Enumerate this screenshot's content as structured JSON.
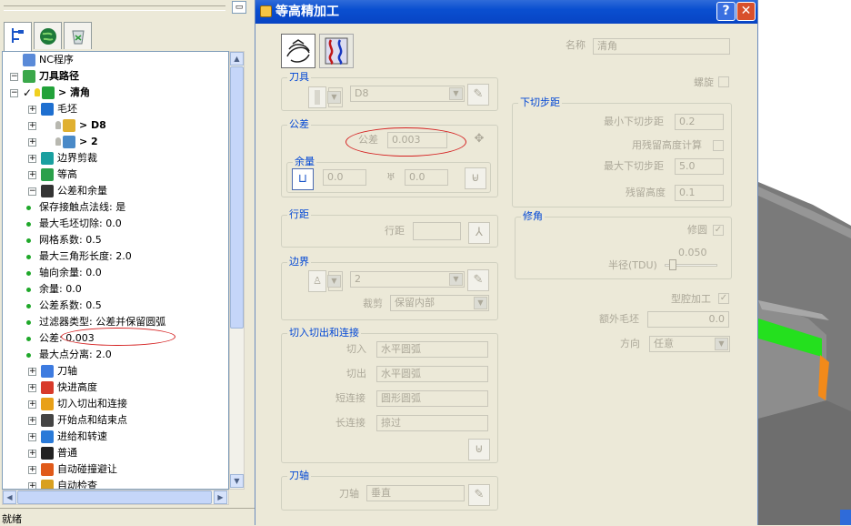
{
  "colors": {
    "title_bar": "#0a4fd0",
    "group_label": "#0046d5",
    "disabled_text": "#aca899",
    "annotation": "#d42020",
    "toolpath_green": "#24e01e",
    "toolpath_orange": "#f28a1a"
  },
  "tree": {
    "items": [
      {
        "label": "NC程序",
        "bold": false,
        "icon": "nc-program-icon",
        "indent": 1,
        "exp": ""
      },
      {
        "label": "刀具路径",
        "bold": true,
        "icon": "toolpath-icon",
        "indent": 0,
        "exp": "-"
      },
      {
        "label": "> 清角",
        "bold": true,
        "icon": "active-toolpath-icon",
        "indent": 1,
        "exp": "-",
        "check": true
      },
      {
        "label": "毛坯",
        "bold": false,
        "icon": "block-icon",
        "indent": 2,
        "exp": "+"
      },
      {
        "label": "> D8",
        "bold": true,
        "icon": "tool-d8-icon",
        "indent": 2,
        "exp": "+",
        "bulb": true
      },
      {
        "label": "> 2",
        "bold": true,
        "icon": "tool-2-icon",
        "indent": 2,
        "exp": "+",
        "bulb": true
      },
      {
        "label": "边界剪裁",
        "bold": false,
        "icon": "boundary-icon",
        "indent": 2,
        "exp": "+"
      },
      {
        "label": "等高",
        "bold": false,
        "icon": "constant-z-icon",
        "indent": 2,
        "exp": "+"
      },
      {
        "label": "公差和余量",
        "bold": false,
        "icon": "tolerance-icon",
        "indent": 2,
        "exp": "-"
      },
      {
        "label": "保存接触点法线: 是",
        "bold": false,
        "dot": true,
        "indent": 3
      },
      {
        "label": "最大毛坯切除: 0.0",
        "bold": false,
        "dot": true,
        "indent": 3
      },
      {
        "label": "网格系数: 0.5",
        "bold": false,
        "dot": true,
        "indent": 3
      },
      {
        "label": "最大三角形长度: 2.0",
        "bold": false,
        "dot": true,
        "indent": 3
      },
      {
        "label": "轴向余量: 0.0",
        "bold": false,
        "dot": true,
        "indent": 3
      },
      {
        "label": "余量: 0.0",
        "bold": false,
        "dot": true,
        "indent": 3
      },
      {
        "label": "公差系数: 0.5",
        "bold": false,
        "dot": true,
        "indent": 3
      },
      {
        "label": "过滤器类型: 公差并保留圆弧",
        "bold": false,
        "dot": true,
        "indent": 3
      },
      {
        "label": "公差: 0.003",
        "bold": false,
        "dot": true,
        "indent": 3
      },
      {
        "label": "最大点分离: 2.0",
        "bold": false,
        "dot": true,
        "indent": 3
      },
      {
        "label": "刀轴",
        "bold": false,
        "icon": "tool-axis-icon",
        "indent": 2,
        "exp": "+"
      },
      {
        "label": "快进高度",
        "bold": false,
        "icon": "rapid-height-icon",
        "indent": 2,
        "exp": "+"
      },
      {
        "label": "切入切出和连接",
        "bold": false,
        "icon": "leads-links-icon",
        "indent": 2,
        "exp": "+"
      },
      {
        "label": "开始点和结束点",
        "bold": false,
        "icon": "start-end-point-icon",
        "indent": 2,
        "exp": "+"
      },
      {
        "label": "进给和转速",
        "bold": false,
        "icon": "feeds-speeds-icon",
        "indent": 2,
        "exp": "+"
      },
      {
        "label": "普通",
        "bold": false,
        "icon": "general-icon",
        "indent": 2,
        "exp": "+"
      },
      {
        "label": "自动碰撞避让",
        "bold": false,
        "icon": "collision-icon",
        "indent": 2,
        "exp": "+"
      },
      {
        "label": "自动检查",
        "bold": false,
        "icon": "auto-verify-icon",
        "indent": 2,
        "exp": "+"
      }
    ]
  },
  "status": {
    "text": "就绪"
  },
  "dialog": {
    "title": "等高精加工",
    "help": "?",
    "close": "✕",
    "name_label": "名称",
    "name_value": "清角",
    "tool": {
      "group": "刀具",
      "value": "D8"
    },
    "spiral_label": "螺旋",
    "stepdown": {
      "group": "下切步距",
      "min_label": "最小下切步距",
      "min_value": "0.2",
      "cusp_calc_label": "用残留高度计算",
      "max_label": "最大下切步距",
      "max_value": "5.0",
      "cusp_label": "残留高度",
      "cusp_value": "0.1"
    },
    "tolerance": {
      "group": "公差",
      "label": "公差",
      "value": "0.003"
    },
    "allowance": {
      "group": "余量",
      "radial": "0.0",
      "axial": "0.0"
    },
    "corner": {
      "group": "修角",
      "round_label": "修圆",
      "radius_label": "半径(TDU)",
      "radius_value": "0.050"
    },
    "stepover": {
      "group": "行距",
      "label": "行距",
      "value": ""
    },
    "boundary": {
      "group": "边界",
      "value": "2",
      "trim_label": "裁剪",
      "trim_value": "保留内部"
    },
    "pocket_label": "型腔加工",
    "extra_stock_label": "额外毛坯",
    "extra_stock_value": "0.0",
    "direction_label": "方向",
    "direction_value": "任意",
    "leads": {
      "group": "切入切出和连接",
      "lead_in_label": "切入",
      "lead_in_value": "水平圆弧",
      "lead_out_label": "切出",
      "lead_out_value": "水平圆弧",
      "short_link_label": "短连接",
      "short_link_value": "圆形圆弧",
      "long_link_label": "长连接",
      "long_link_value": "掠过"
    },
    "axis": {
      "group": "刀轴",
      "label": "刀轴",
      "value": "垂直"
    }
  }
}
